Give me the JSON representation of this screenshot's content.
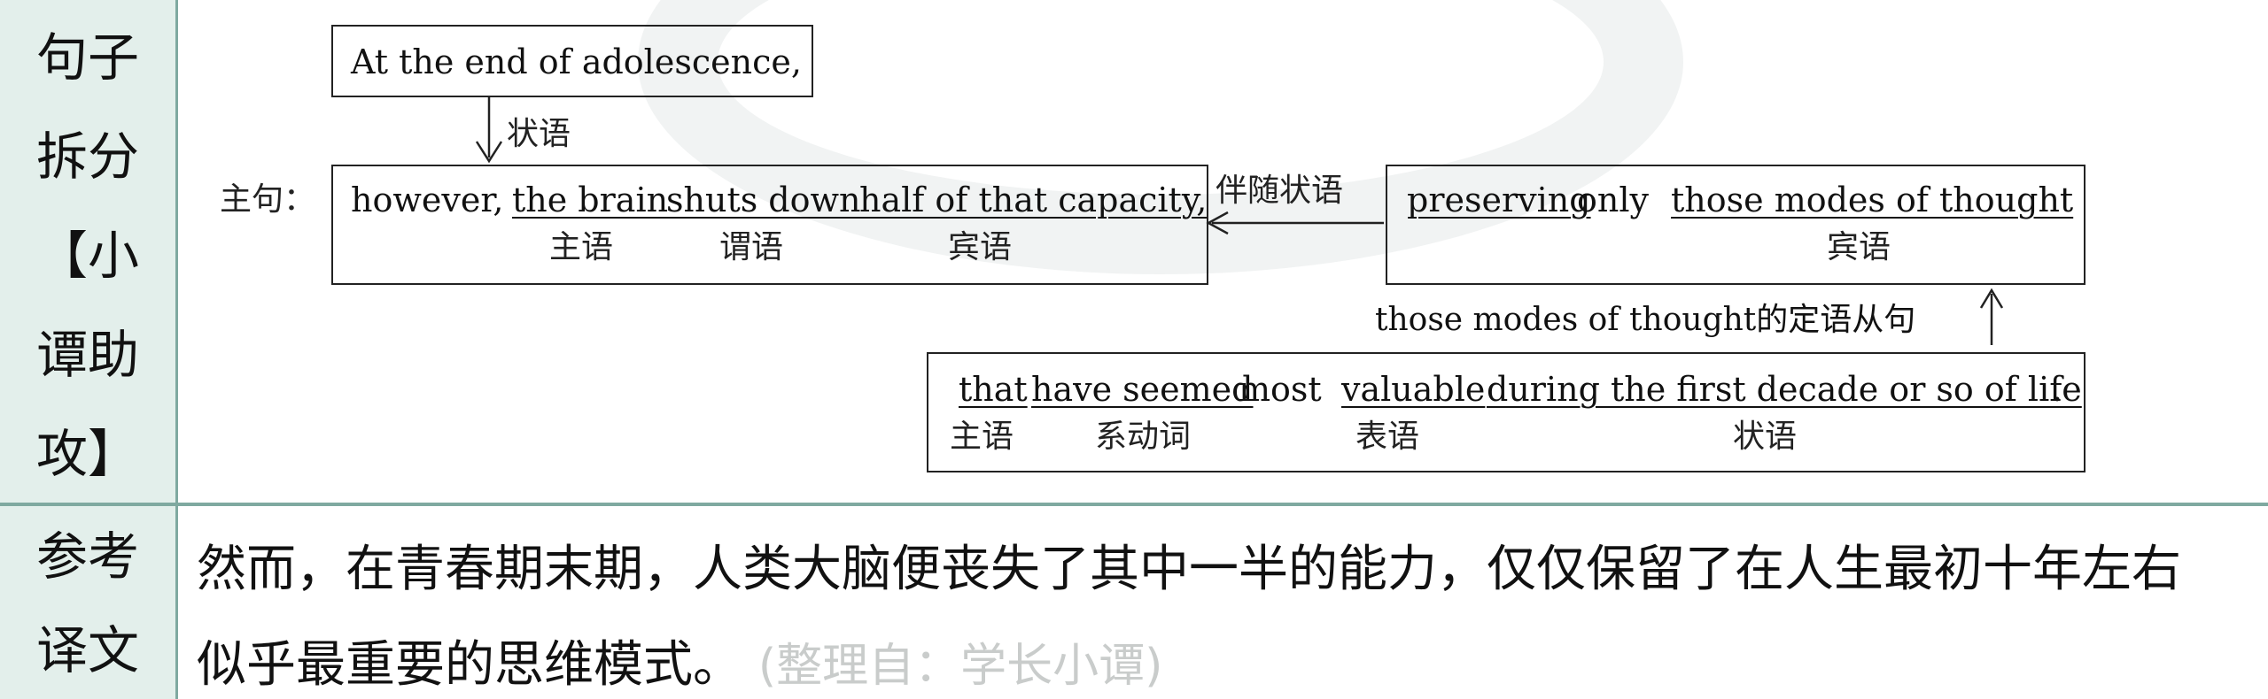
{
  "row1": {
    "header": [
      "句子",
      "拆分",
      "【小",
      "谭助",
      "攻】"
    ],
    "top_box": "At the end of adolescence,",
    "top_arrow_label": "状语",
    "main_label": "主句：",
    "main_clause": {
      "w1": "however, ",
      "subject": "the brain",
      "verb": "shuts down",
      "object": "half of that capacity,",
      "subject_tag": "主语",
      "verb_tag": "谓语",
      "object_tag": "宾语"
    },
    "side_arrow_label": "伴随状语",
    "participle": {
      "verb": "preserving",
      "mid": " only ",
      "object": "those modes of thought",
      "object_tag": "宾语"
    },
    "relative_label": "those modes of thought的定语从句",
    "relative": {
      "that": "that",
      "have": "have seemed",
      "most": " most ",
      "valuable": "valuable",
      "during": "during the first decade or so of life",
      "period": ".",
      "tag_subject": "主语",
      "tag_link": "系动词",
      "tag_pred": "表语",
      "tag_adv": "状语"
    }
  },
  "row2": {
    "header": [
      "参考",
      "译文"
    ],
    "line1": "然而，在青春期末期，人类大脑便丧失了其中一半的能力，仅仅保留了在人生最初十年左右",
    "line2": "似乎最重要的思维模式。",
    "source": "(整理自：学长小谭)"
  },
  "colors": {
    "header_bg": "#e3efeb",
    "rule": "#7fa9a0"
  }
}
